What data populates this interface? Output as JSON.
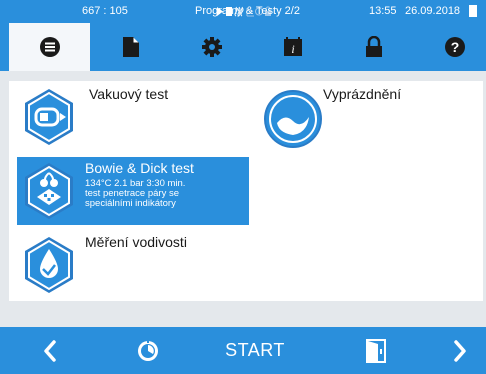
{
  "status_bar": {
    "counter": "667 : 105",
    "screen_title": "Programy & Testy 2/2",
    "time": "13:55",
    "date": "26.09.2018"
  },
  "tabs": [
    {
      "icon": "list-icon",
      "active": true
    },
    {
      "icon": "document-icon",
      "active": false
    },
    {
      "icon": "gear-icon",
      "active": false
    },
    {
      "icon": "info-book-icon",
      "active": false
    },
    {
      "icon": "lock-icon",
      "active": false
    },
    {
      "icon": "help-icon",
      "active": false
    }
  ],
  "programs": {
    "vacuum": {
      "label": "Vakuový test"
    },
    "drain": {
      "label": "Vyprázdnění"
    },
    "bowie": {
      "label": "Bowie & Dick test",
      "line1": "134°C 2.1 bar 3:30 min.",
      "line2": "test penetrace páry se",
      "line3": "speciálními indikátory"
    },
    "conductivity": {
      "label": "Měření vodivosti"
    }
  },
  "bottom_bar": {
    "start_label": "START"
  },
  "colors": {
    "accent": "#2a8fdc",
    "content_bg": "#e4e8ec"
  }
}
